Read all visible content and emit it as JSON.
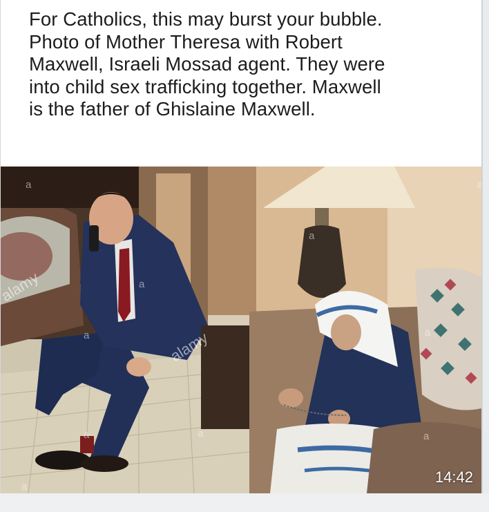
{
  "post": {
    "text_lines": [
      "For Catholics, this may burst your bubble.",
      "Photo of Mother Theresa with Robert",
      "Maxwell, Israeli Mossad agent. They were",
      "into child sex trafficking together. Maxwell",
      "is the father of Ghislaine Maxwell."
    ]
  },
  "photo": {
    "watermarks": [
      "alamy",
      "alamy"
    ],
    "timestamp": "14:42"
  }
}
